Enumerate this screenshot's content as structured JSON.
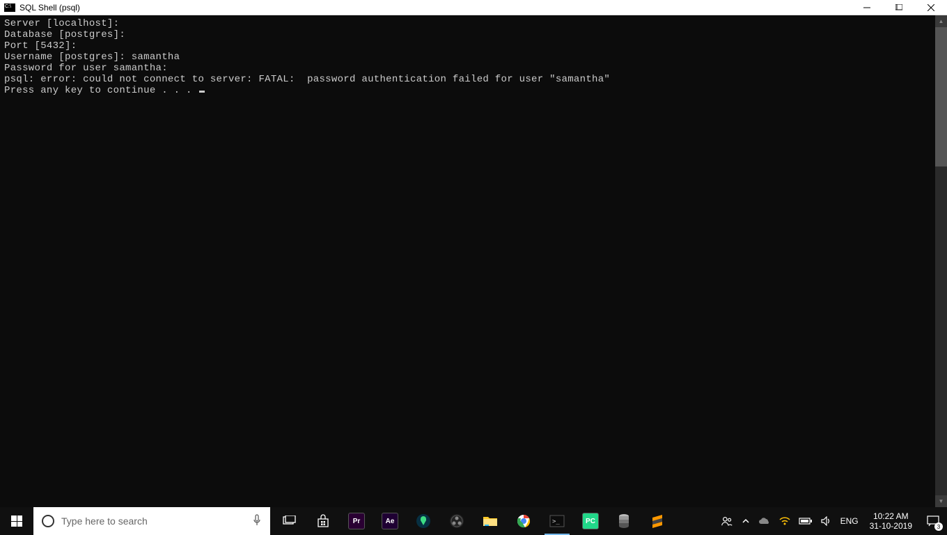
{
  "window": {
    "title": "SQL Shell (psql)"
  },
  "terminal": {
    "lines": [
      "Server [localhost]:",
      "Database [postgres]:",
      "Port [5432]:",
      "Username [postgres]: samantha",
      "Password for user samantha:",
      "psql: error: could not connect to server: FATAL:  password authentication failed for user \"samantha\"",
      "Press any key to continue . . . "
    ]
  },
  "taskbar": {
    "search_placeholder": "Type here to search",
    "apps": [
      {
        "name": "task-view",
        "label": "",
        "color": "transparent"
      },
      {
        "name": "microsoft-store",
        "label": "",
        "color": "transparent"
      },
      {
        "name": "premiere",
        "label": "Pr",
        "color": "#2a0033"
      },
      {
        "name": "after-effects",
        "label": "Ae",
        "color": "#1f0033"
      },
      {
        "name": "android-studio",
        "label": "",
        "color": "#3ddc84"
      },
      {
        "name": "obs",
        "label": "",
        "color": "#222"
      },
      {
        "name": "file-explorer",
        "label": "",
        "color": "#ffca28"
      },
      {
        "name": "chrome",
        "label": "",
        "color": "transparent"
      },
      {
        "name": "cmd",
        "label": "",
        "color": "#222"
      },
      {
        "name": "pycharm",
        "label": "PC",
        "color": "#21d789"
      },
      {
        "name": "database",
        "label": "",
        "color": "#888"
      },
      {
        "name": "sublime",
        "label": "",
        "color": "#ff9800"
      }
    ],
    "tray": {
      "language": "ENG",
      "time": "10:22 AM",
      "date": "31-10-2019",
      "notifications": "3"
    }
  }
}
